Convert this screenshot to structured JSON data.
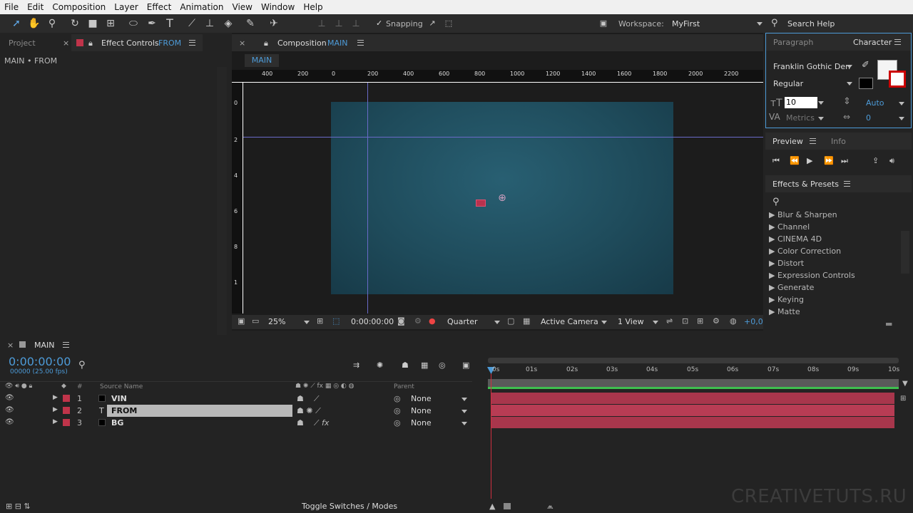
{
  "menubar": {
    "items": [
      "File",
      "Edit",
      "Composition",
      "Layer",
      "Effect",
      "Animation",
      "View",
      "Window",
      "Help"
    ]
  },
  "toolbar": {
    "snapping_label": "Snapping",
    "workspace_label": "Workspace:",
    "workspace_value": "MyFirst",
    "search_help": "Search Help"
  },
  "project_panel": {
    "tab_project": "Project",
    "tab_effect_controls_prefix": "Effect Controls",
    "tab_effect_controls_layer": "FROM",
    "breadcrumb": "MAIN • FROM"
  },
  "composition_panel": {
    "tab_prefix": "Composition",
    "tab_name": "MAIN",
    "comp_tab": "MAIN",
    "ruler_h": [
      "400",
      "200",
      "0",
      "200",
      "400",
      "600",
      "800",
      "1000",
      "1200",
      "1400",
      "1600",
      "1800",
      "2000",
      "2200"
    ],
    "ruler_v": [
      "0",
      "2",
      "4",
      "6",
      "8",
      "1"
    ],
    "zoom": "25%",
    "timecode": "0:00:00:00",
    "resolution": "Quarter",
    "camera": "Active Camera",
    "views": "1 View",
    "exposure": "+0,0",
    "background_color": "#1f4c5c"
  },
  "character_panel": {
    "tab_paragraph": "Paragraph",
    "tab_character": "Character",
    "font_family": "Franklin Gothic Den",
    "font_style": "Regular",
    "font_size": "10",
    "leading": "Auto",
    "kerning": "Metrics",
    "tracking": "0"
  },
  "preview_panel": {
    "tab_preview": "Preview",
    "tab_info": "Info"
  },
  "effects_presets": {
    "title": "Effects & Presets",
    "items": [
      "Blur & Sharpen",
      "Channel",
      "CINEMA 4D",
      "Color Correction",
      "Distort",
      "Expression Controls",
      "Generate",
      "Keying",
      "Matte"
    ]
  },
  "timeline": {
    "tab": "MAIN",
    "timecode": "0:00:00:00",
    "frame_info": "00000 (25.00 fps)",
    "col_num": "#",
    "col_source": "Source Name",
    "col_parent": "Parent",
    "layers": [
      {
        "num": "1",
        "name": "VIN",
        "parent": "None"
      },
      {
        "num": "2",
        "name": "FROM",
        "parent": "None"
      },
      {
        "num": "3",
        "name": "BG",
        "parent": "None"
      }
    ],
    "ticks": [
      "0s",
      "01s",
      "02s",
      "03s",
      "04s",
      "05s",
      "06s",
      "07s",
      "08s",
      "09s",
      "10s"
    ],
    "toggle_label": "Toggle Switches / Modes",
    "label_color": "#c0344a"
  },
  "watermark": "CREATIVETUTS.RU"
}
